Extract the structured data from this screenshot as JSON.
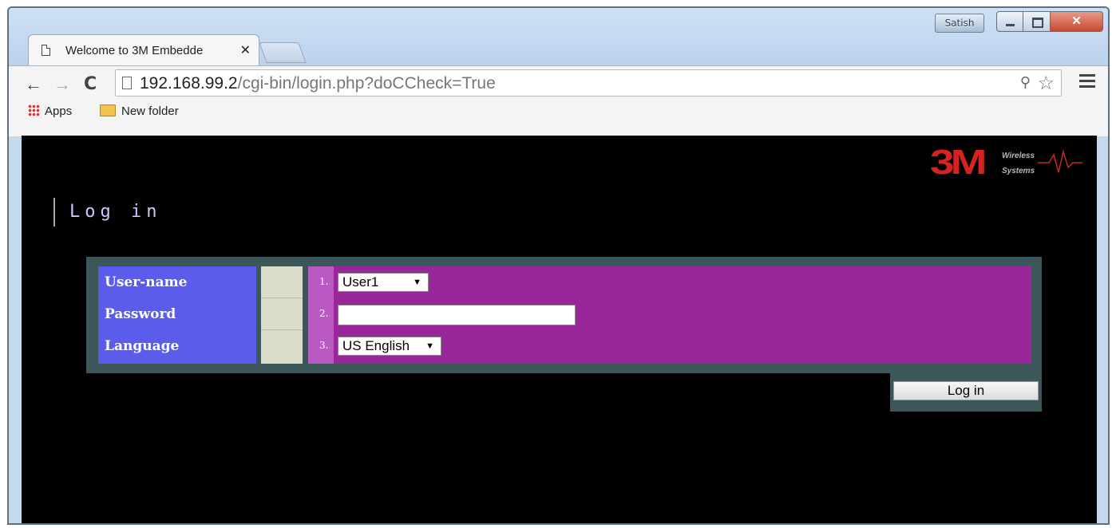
{
  "window": {
    "user_badge": "Satish",
    "minimize_glyph": "",
    "maximize_glyph": "",
    "close_glyph": "✕"
  },
  "tab": {
    "title": "Welcome to 3M Embedde",
    "close_glyph": "✕"
  },
  "toolbar": {
    "back_glyph": "←",
    "forward_glyph": "→",
    "reload_glyph": "C",
    "url_host": "192.168.99.2",
    "url_path": "/cgi-bin/login.php?doCCheck=True",
    "zoom_glyph": "⚲",
    "star_glyph": "☆"
  },
  "bookmarks": [
    {
      "label": "Apps",
      "icon": "apps-icon"
    },
    {
      "label": "New folder",
      "icon": "folder-icon"
    }
  ],
  "page": {
    "logo_mark": "3M",
    "logo_tag1": "Wireless",
    "logo_tag2": "Systems",
    "heading": "Log in",
    "fields": [
      {
        "number": "1.",
        "label": "User-name",
        "value": "User1"
      },
      {
        "number": "2.",
        "label": "Password",
        "value": ""
      },
      {
        "number": "3.",
        "label": "Language",
        "value": "US English"
      }
    ],
    "dropdown_arrow": "▼",
    "login_button": "Log in"
  },
  "colors": {
    "label_column": "#5b5cec",
    "input_column": "#99279b",
    "number_column": "#bb59c3",
    "frame": "#3c5759",
    "brand_red": "#d5241f"
  }
}
